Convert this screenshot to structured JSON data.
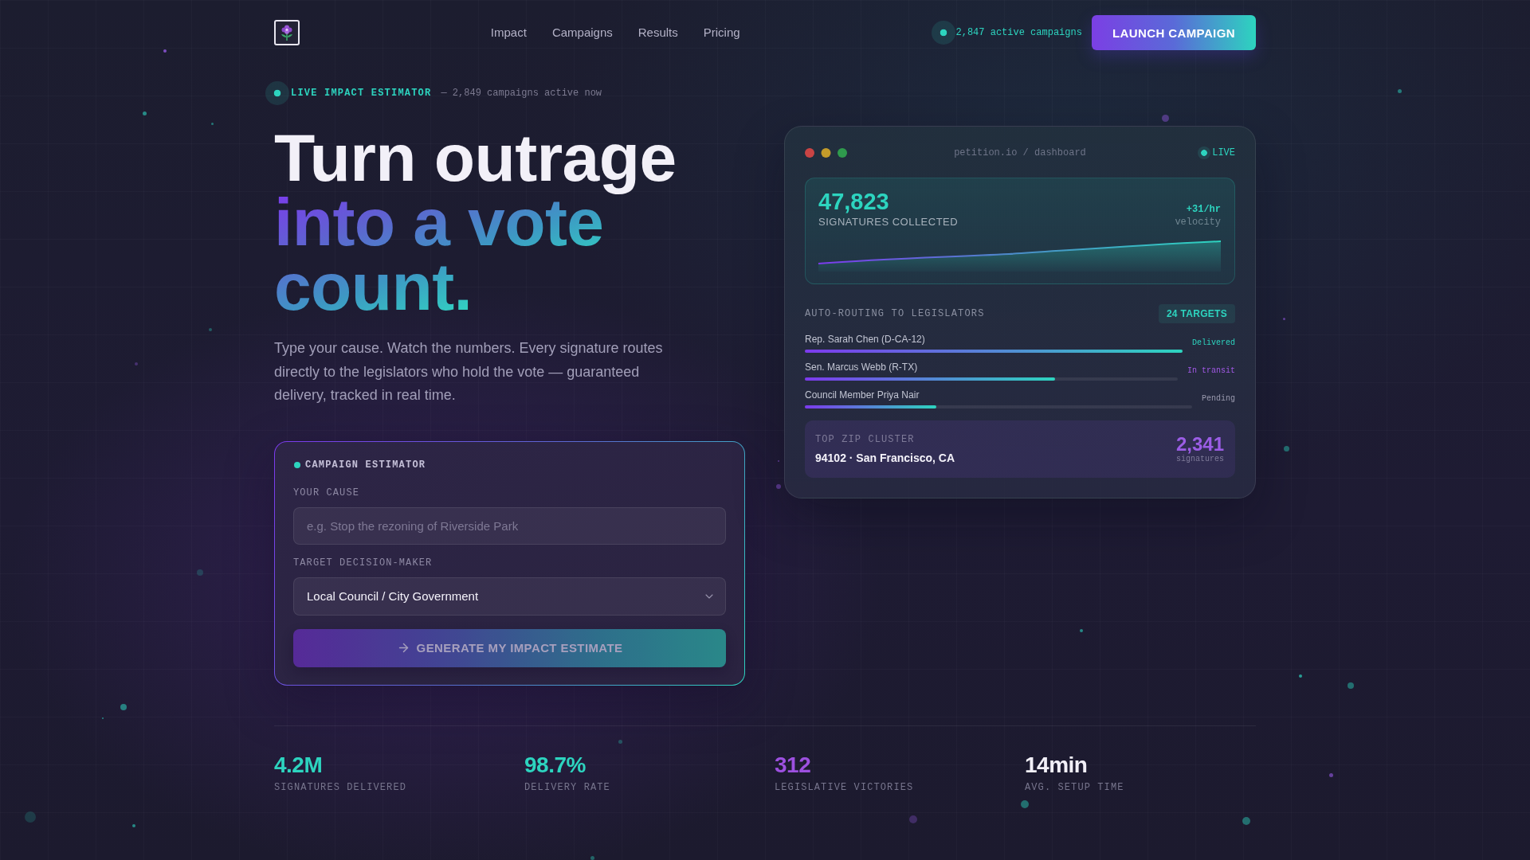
{
  "header": {
    "nav_links": [
      "Impact",
      "Campaigns",
      "Results",
      "Pricing"
    ],
    "active_campaigns": "2,847 active campaigns",
    "cta": "LAUNCH CAMPAIGN"
  },
  "hero": {
    "eyebrow": "LIVE IMPACT ESTIMATOR",
    "eyebrow_note": "— 2,849 campaigns active now",
    "headline": {
      "lead": "Turn outrage",
      "accent": "into a vote count."
    },
    "intro": "Type your cause. Watch the numbers. Every signature routes directly to the legislators who hold the vote — guaranteed delivery, tracked in real time."
  },
  "estimator": {
    "title": "CAMPAIGN ESTIMATOR",
    "fields": [
      {
        "kind": "text",
        "label": "YOUR CAUSE",
        "placeholder": "e.g. Stop the rezoning of Riverside Park"
      },
      {
        "kind": "select",
        "label": "TARGET DECISION-MAKER",
        "value": "Local Council / City Government"
      }
    ],
    "submit": {
      "label": "GENERATE MY IMPACT ESTIMATE",
      "disabled": true
    }
  },
  "dashboard": {
    "address": "petition.io / dashboard",
    "live": "LIVE",
    "signatures": {
      "count": "47,823",
      "label": "SIGNATURES COLLECTED",
      "rate": "+31/hr",
      "rate_label": "velocity"
    },
    "routing": {
      "title": "AUTO-ROUTING TO LEGISLATORS",
      "badge": "24 TARGETS",
      "legislators": [
        {
          "name": "Rep. Sarah Chen (D-CA-12)",
          "level": 1,
          "status": "Delivered",
          "color": "#2dd4bf"
        },
        {
          "name": "Sen. Marcus Webb (R-TX)",
          "level": 0.67,
          "status": "In transit",
          "color": "#a259e6"
        },
        {
          "name": "Council Member Priya Nair",
          "level": 0.34,
          "status": "Pending",
          "color": "#9a9aae"
        }
      ]
    },
    "zip_cluster": {
      "label": "TOP ZIP CLUSTER",
      "place": "94102 · San Francisco, CA",
      "count": "2,341",
      "count_label": "signatures"
    }
  },
  "stats": [
    {
      "value": "4.2M",
      "label": "SIGNATURES DELIVERED",
      "color": "#2dd4bf"
    },
    {
      "value": "98.7%",
      "label": "DELIVERY RATE",
      "color": "#2dd4bf"
    },
    {
      "value": "312",
      "label": "LEGISLATIVE VICTORIES",
      "color": "#9d50e0"
    },
    {
      "value": "14min",
      "label": "AVG. SETUP TIME",
      "color": "#f2f0f8"
    }
  ]
}
